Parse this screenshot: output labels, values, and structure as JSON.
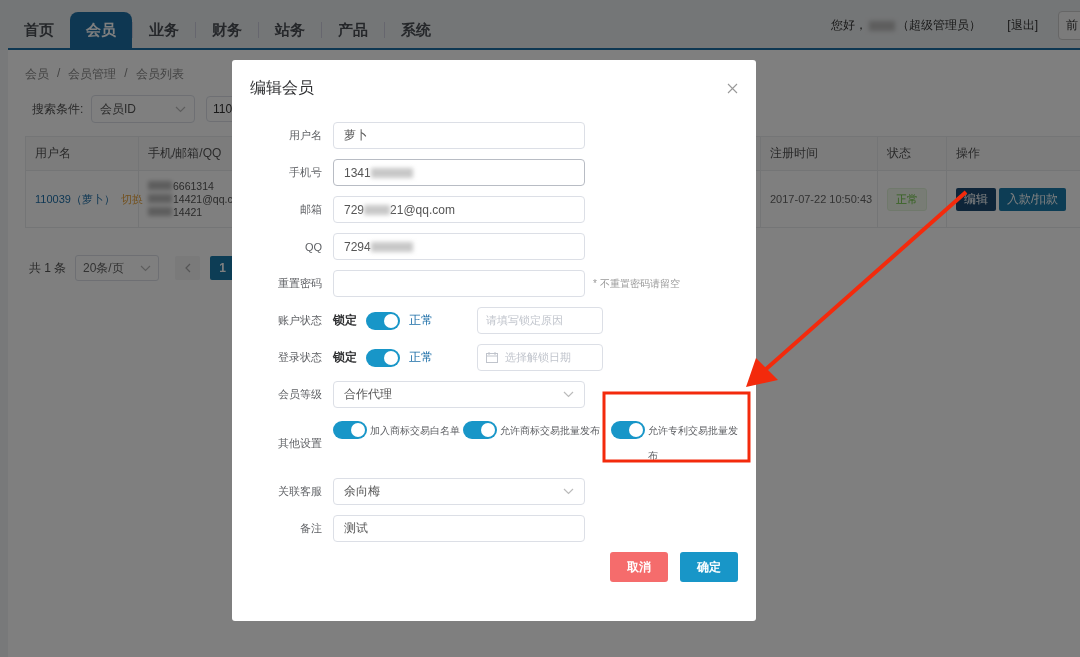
{
  "header": {
    "tabs": [
      {
        "label": "首页",
        "selected": false
      },
      {
        "label": "会员",
        "selected": true
      },
      {
        "label": "业务",
        "selected": false
      },
      {
        "label": "财务",
        "selected": false
      },
      {
        "label": "站务",
        "selected": false
      },
      {
        "label": "产品",
        "selected": false
      },
      {
        "label": "系统",
        "selected": false
      }
    ],
    "greeting": "您好，",
    "user_redacted": true,
    "role": "（超级管理员）",
    "logout": "[退出]",
    "front_button": "前"
  },
  "breadcrumb": {
    "items": [
      "会员",
      "会员管理",
      "会员列表"
    ],
    "separator": "/"
  },
  "search": {
    "label": "搜索条件:",
    "field": "会员ID",
    "value": "110"
  },
  "table": {
    "columns": [
      "用户名",
      "手机/邮箱/QQ",
      "注册时间",
      "状态",
      "操作"
    ],
    "rows": [
      {
        "user": "110039（萝卜）",
        "switch_link": "切换",
        "contacts": [
          {
            "text": "6661314",
            "redacted": true
          },
          {
            "text": "14421@qq.c",
            "redacted": true
          },
          {
            "text": "14421",
            "redacted": true
          }
        ],
        "registered": "2017-07-22 10:50:43",
        "status": "正常",
        "actions": [
          "编辑",
          "入款/扣款"
        ]
      }
    ]
  },
  "pagination": {
    "total": "共 1 条",
    "page_size": "20条/页",
    "pages": [
      {
        "label": "1",
        "selected": true
      }
    ]
  },
  "dialog": {
    "title": "编辑会员",
    "fields": [
      {
        "kind": "text",
        "label": "用户名",
        "value": "萝卜",
        "redacted": false
      },
      {
        "kind": "text",
        "label": "手机号",
        "value": "1341",
        "redacted": true
      },
      {
        "kind": "text",
        "label": "邮箱",
        "value": "729",
        "redacted": true,
        "value_after": "21@qq.com"
      },
      {
        "kind": "text",
        "label": "QQ",
        "value": "7294",
        "redacted": true
      },
      {
        "kind": "password",
        "label": "重置密码",
        "hint": "* 不重置密码请留空"
      },
      {
        "kind": "status",
        "label": "账户状态",
        "off_label": "锁定",
        "on_label": "正常",
        "on": true,
        "placeholder": "请填写锁定原因",
        "calendar_icon": false
      },
      {
        "kind": "status",
        "label": "登录状态",
        "off_label": "锁定",
        "on_label": "正常",
        "on": true,
        "placeholder": "选择解锁日期",
        "calendar_icon": true
      },
      {
        "kind": "select",
        "label": "会员等级",
        "value": "合作代理"
      },
      {
        "kind": "switches",
        "label": "其他设置",
        "switches": [
          {
            "label": "加入商标交易白名单",
            "on": true
          },
          {
            "label": "允许商标交易批量发布",
            "on": true
          },
          {
            "label": "允许专利交易批量发布",
            "on": true
          }
        ]
      },
      {
        "kind": "select",
        "label": "关联客服",
        "value": "余向梅"
      },
      {
        "kind": "text",
        "label": "备注",
        "value": "测试",
        "redacted": false
      }
    ],
    "buttons": [
      {
        "kind": "cancel",
        "label": "取消"
      },
      {
        "kind": "confirm",
        "label": "确定"
      }
    ]
  }
}
